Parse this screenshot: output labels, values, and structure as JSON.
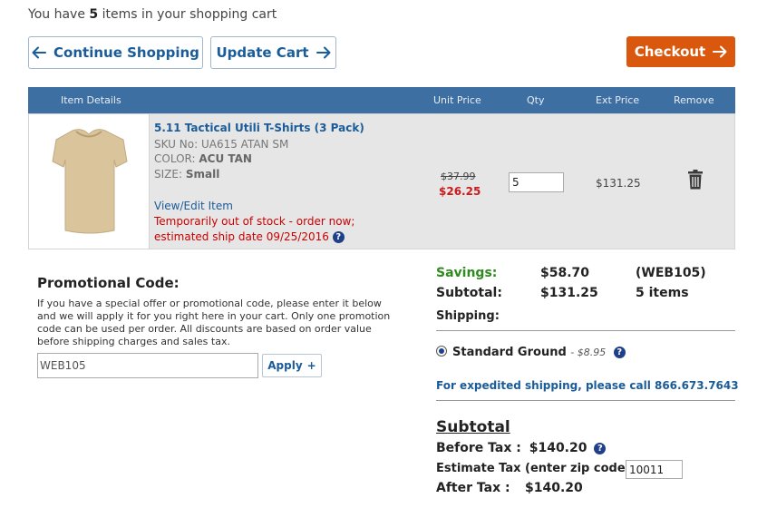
{
  "cart": {
    "count_prefix": "You have",
    "count": "5",
    "count_suffix": "items in your shopping cart"
  },
  "buttons": {
    "continue": "Continue Shopping",
    "update": "Update Cart",
    "checkout": "Checkout"
  },
  "table": {
    "headers": [
      "Item Details",
      "Unit Price",
      "Qty",
      "Ext Price",
      "Remove"
    ]
  },
  "item": {
    "name": "5.11 Tactical Utili T-Shirts (3 Pack)",
    "sku_label": "SKU No:",
    "sku": "UA615 ATAN SM",
    "color_label": "COLOR:",
    "color": "ACU TAN",
    "size_label": "SIZE:",
    "size": "Small",
    "view_edit": "View/Edit Item",
    "stock_line1": "Temporarily out of stock - order now;",
    "stock_line2": "estimated ship date 09/25/2016",
    "price_old": "$37.99",
    "price_new": "$26.25",
    "qty": "5",
    "ext_price": "$131.25",
    "image_color": "#d9c49c"
  },
  "promo": {
    "title": "Promotional Code:",
    "description": "If you have a special offer or promotional code, please enter it below and we will apply it for you right here in your cart. Only one promotion code can be used per order. All discounts are based on order value before shipping charges and sales tax.",
    "code_value": "WEB105",
    "apply_label": "Apply"
  },
  "summary": {
    "savings_label": "Savings:",
    "savings_value": "$58.70",
    "savings_code": "(WEB105)",
    "subtotal_label": "Subtotal:",
    "subtotal_value": "$131.25",
    "items_text": "5 items",
    "shipping_label": "Shipping:",
    "shipping_option": "Standard Ground",
    "shipping_price": "- $8.95",
    "expedite_text": "For expedited shipping, please call 866.673.7643"
  },
  "totals": {
    "heading": "Subtotal",
    "before_tax_label": "Before Tax :",
    "before_tax_value": "$140.20",
    "estimate_label": "Estimate Tax (enter zip code):",
    "zip_value": "10011",
    "after_tax_label": "After Tax :",
    "after_tax_value": "$140.20"
  },
  "colors": {
    "brand_blue": "#1a5c99",
    "header_bar": "#3d6fa3",
    "checkout_orange": "#d9580e",
    "savings_green": "#2e8b1e",
    "sale_red": "#cc1a1a"
  }
}
